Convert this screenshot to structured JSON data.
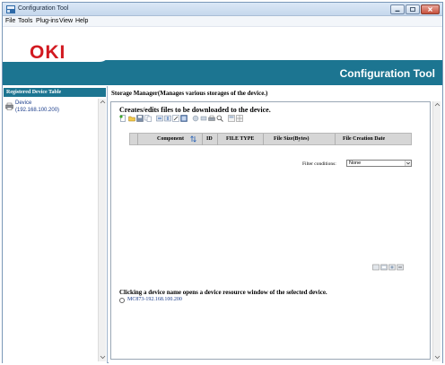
{
  "window": {
    "title": "Configuration Tool"
  },
  "menubar": {
    "items": [
      "File",
      "Tools",
      "Plug-ins",
      "View",
      "Help"
    ]
  },
  "brand": {
    "logo": "OKI",
    "product_title": "Configuration Tool",
    "accent": "#1c7591",
    "logo_color": "#d21920"
  },
  "sidebar": {
    "header": "Registered Device Table",
    "device_label": "Device",
    "device_ip": "(192.168.100.200)"
  },
  "main": {
    "title": "Storage Manager(Manages various storages of the device.)",
    "panel_heading": "Creates/edits files to be downloaded to the device.",
    "columns": [
      "Component",
      "ID",
      "FILE TYPE",
      "File Size(Bytes)",
      "File Creation Date"
    ],
    "filter_label": "Filter conditions:",
    "filter_value": "None",
    "device_section_heading": "Clicking a device name opens a device resource window of the selected device.",
    "device_entry": "MC873-192.168.100.200"
  },
  "icons": {
    "toolbar": [
      "new-icon",
      "open-icon",
      "save-icon",
      "copy-icon",
      "import-icon",
      "export-icon",
      "edit-icon",
      "delete-icon",
      "up-icon",
      "down-icon",
      "print-icon",
      "search-icon",
      "view-icon",
      "grid-icon"
    ],
    "bottom": [
      "add-icon",
      "properties-icon",
      "refresh-icon",
      "remove-icon"
    ]
  }
}
